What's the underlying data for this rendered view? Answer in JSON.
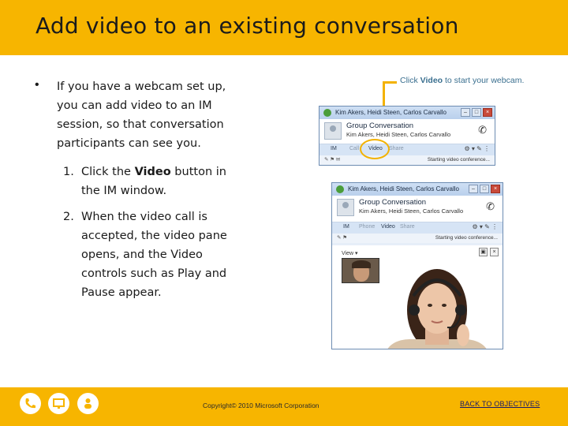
{
  "slide": {
    "title": "Add video to an existing conversation",
    "bullet": "If you have a webcam set up, you can add video to an IM session, so that conversation participants can see you.",
    "steps": [
      {
        "num": "1.",
        "pre": "Click the ",
        "bold": "Video",
        "post": " button in the IM window."
      },
      {
        "num": "2.",
        "text": "When the video call is accepted, the video pane opens, and the Video controls such as Play and Pause appear."
      }
    ],
    "callout": {
      "pre": "Click ",
      "bold": "Video",
      "post": " to start your webcam."
    }
  },
  "im_window_1": {
    "title": "Kim Akers, Heidi Steen, Carlos Carvallo",
    "conversation_title": "Group Conversation",
    "participants": "Kim Akers, Heidi Steen, Carlos Carvallo",
    "tabs": [
      "IM",
      "Call",
      "Video",
      "Share"
    ],
    "status": "Starting video conference..."
  },
  "im_window_2": {
    "title": "Kim Akers, Heidi Steen, Carlos Carvallo",
    "conversation_title": "Group Conversation",
    "participants": "Kim Akers, Heidi Steen, Carlos Carvallo",
    "tabs": [
      "IM",
      "Phone",
      "Video",
      "Share"
    ],
    "status": "Starting video conference...",
    "view_label": "View"
  },
  "footer": {
    "copyright": "Copyright© 2010 Microsoft Corporation",
    "back_link": "BACK TO OBJECTIVES",
    "icons": [
      "phone-icon",
      "presentation-icon",
      "person-icon"
    ]
  },
  "colors": {
    "accent": "#f7b500",
    "callout_text": "#3a6f8f"
  }
}
